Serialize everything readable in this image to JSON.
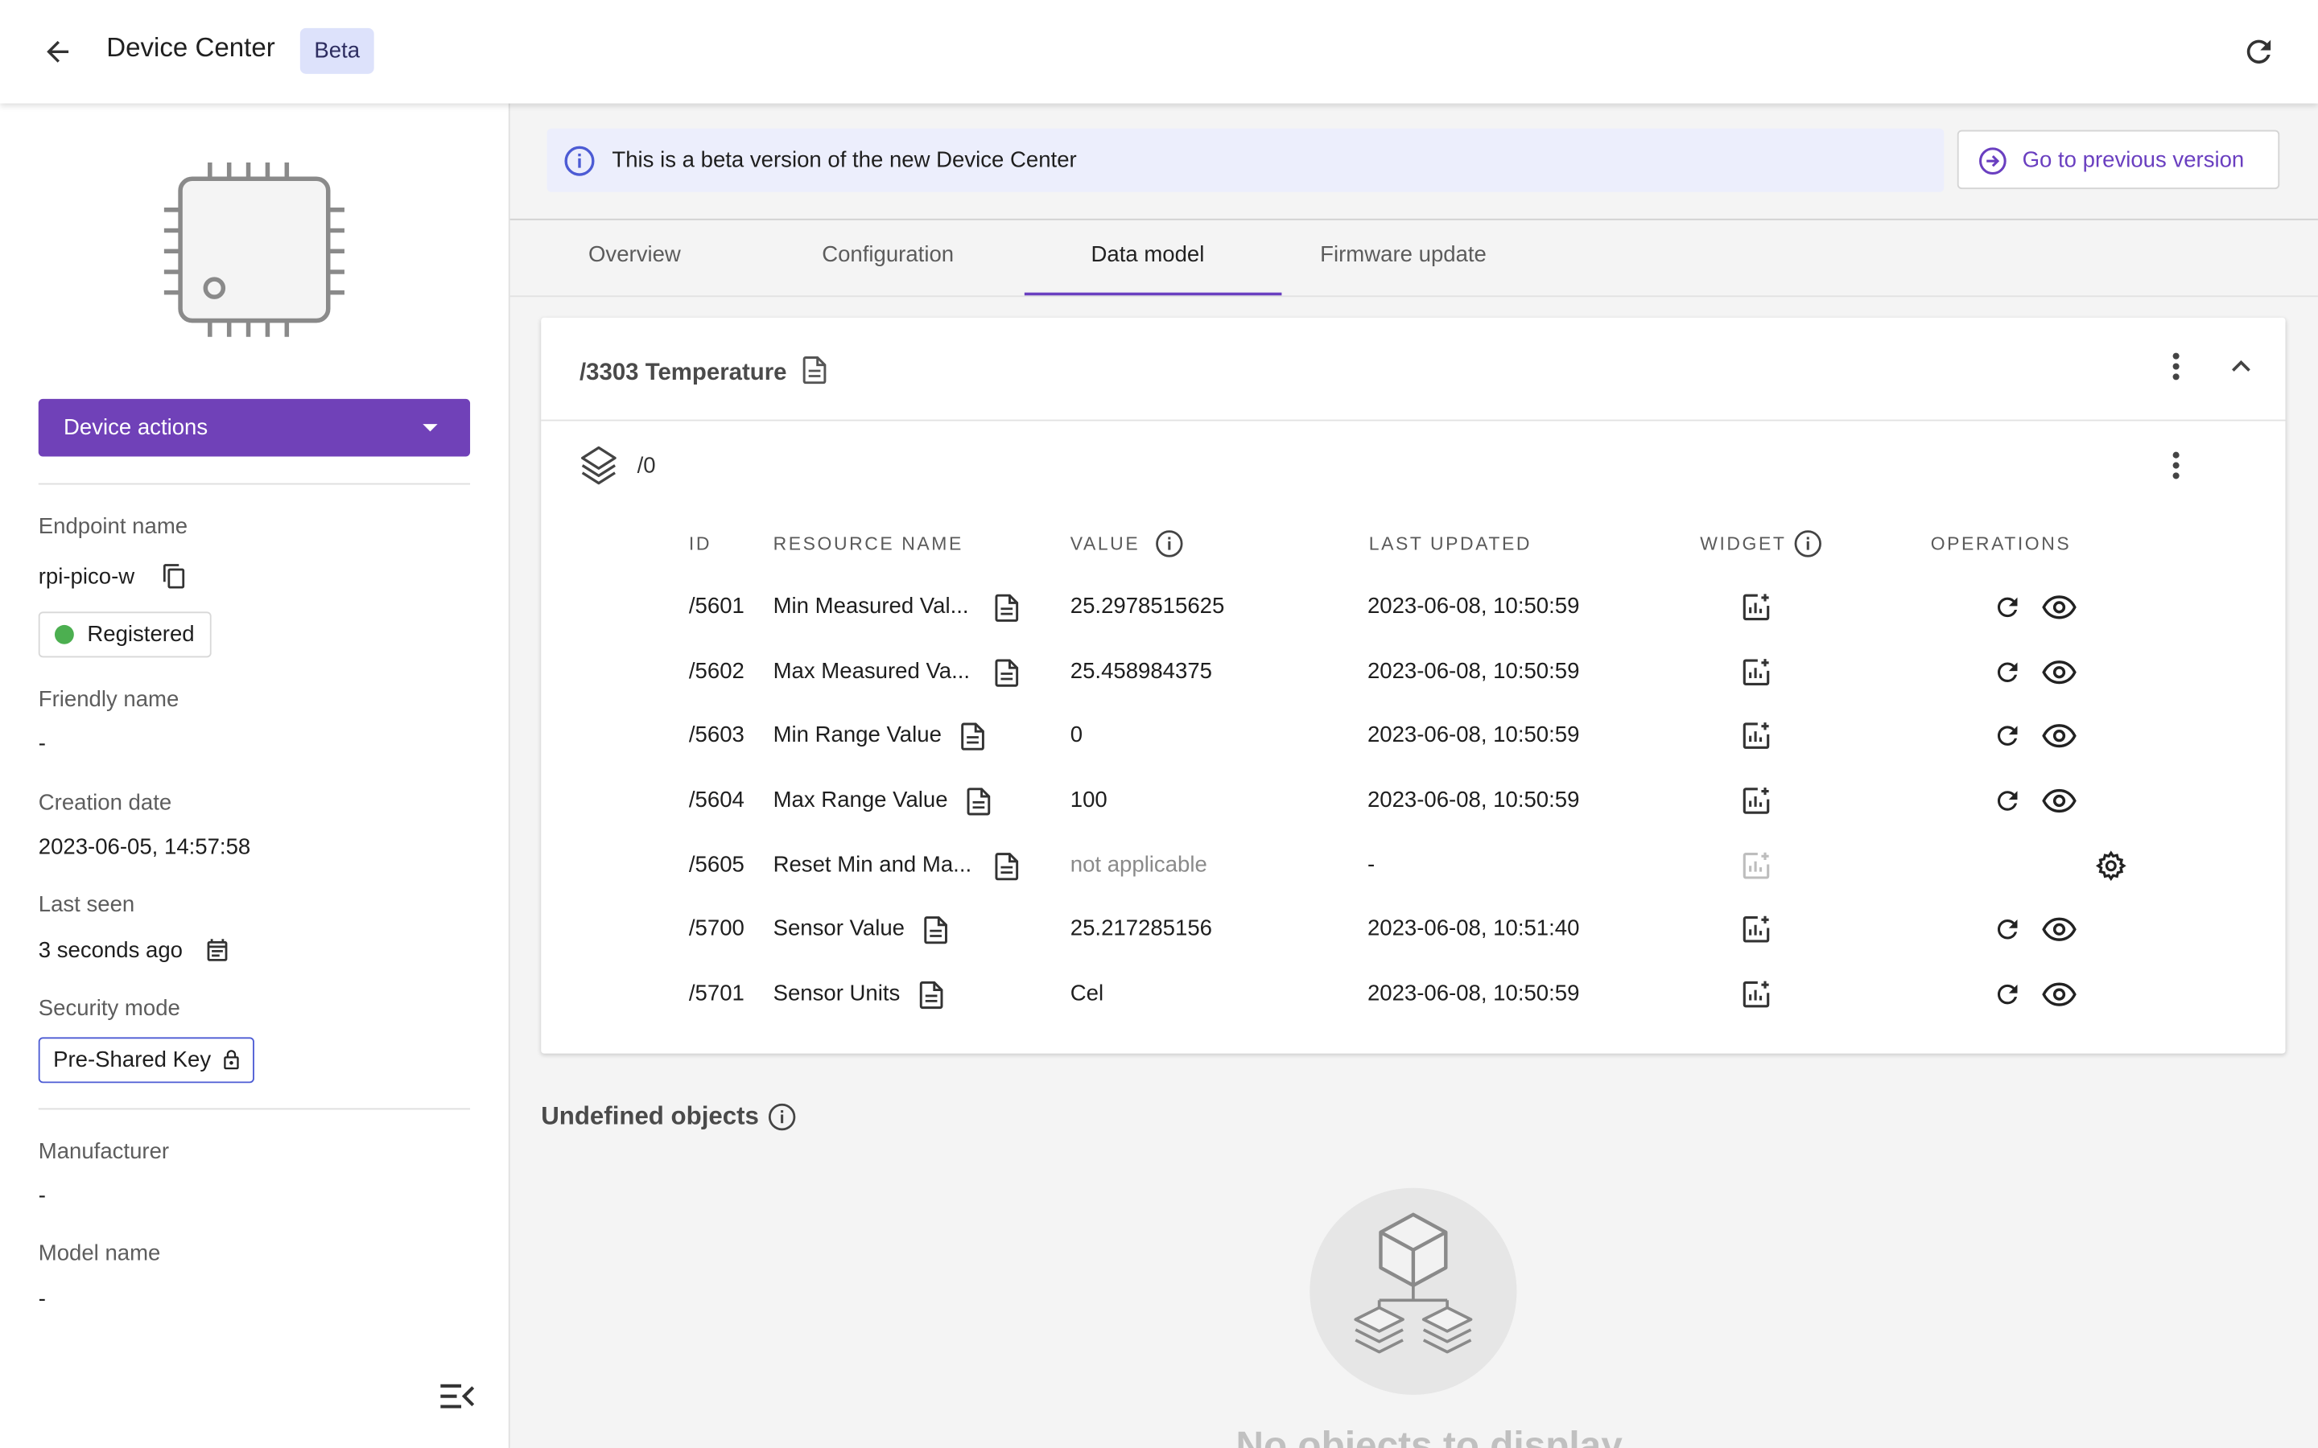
{
  "header": {
    "title": "Device Center",
    "badge": "Beta"
  },
  "sidebar": {
    "device_actions_label": "Device actions",
    "endpoint_name_label": "Endpoint name",
    "endpoint_name": "rpi-pico-w",
    "status": "Registered",
    "friendly_name_label": "Friendly name",
    "friendly_name": "-",
    "creation_date_label": "Creation date",
    "creation_date": "2023-06-05, 14:57:58",
    "last_seen_label": "Last seen",
    "last_seen": "3 seconds ago",
    "security_mode_label": "Security mode",
    "security_mode": "Pre-Shared Key",
    "manufacturer_label": "Manufacturer",
    "manufacturer": "-",
    "model_name_label": "Model name",
    "model_name": "-"
  },
  "banner": {
    "text": "This is a beta version of the new Device Center",
    "prev_version_label": "Go to previous version"
  },
  "tabs": [
    {
      "label": "Overview"
    },
    {
      "label": "Configuration"
    },
    {
      "label": "Data model"
    },
    {
      "label": "Firmware update"
    }
  ],
  "object": {
    "title": "/3303 Temperature",
    "instance": "/0",
    "columns": {
      "id": "ID",
      "resource_name": "RESOURCE NAME",
      "value": "VALUE",
      "last_updated": "LAST UPDATED",
      "widget": "WIDGET",
      "operations": "OPERATIONS"
    },
    "rows": [
      {
        "id": "/5601",
        "name": "Min Measured Val...",
        "value": "25.2978515625",
        "last_updated": "2023-06-08, 10:50:59"
      },
      {
        "id": "/5602",
        "name": "Max Measured Va...",
        "value": "25.458984375",
        "last_updated": "2023-06-08, 10:50:59"
      },
      {
        "id": "/5603",
        "name": "Min Range Value",
        "value": "0",
        "last_updated": "2023-06-08, 10:50:59"
      },
      {
        "id": "/5604",
        "name": "Max Range Value",
        "value": "100",
        "last_updated": "2023-06-08, 10:50:59"
      },
      {
        "id": "/5605",
        "name": "Reset Min and Ma...",
        "value": "not applicable",
        "last_updated": "-"
      },
      {
        "id": "/5700",
        "name": "Sensor Value",
        "value": "25.217285156",
        "last_updated": "2023-06-08, 10:51:40"
      },
      {
        "id": "/5701",
        "name": "Sensor Units",
        "value": "Cel",
        "last_updated": "2023-06-08, 10:50:59"
      }
    ]
  },
  "undefined_objects": {
    "title": "Undefined objects",
    "empty_text": "No objects to display"
  },
  "colors": {
    "accent": "#7041b8",
    "link": "#6a3fc0",
    "banner_bg": "#eceefc",
    "registered_dot": "#4caf50"
  }
}
